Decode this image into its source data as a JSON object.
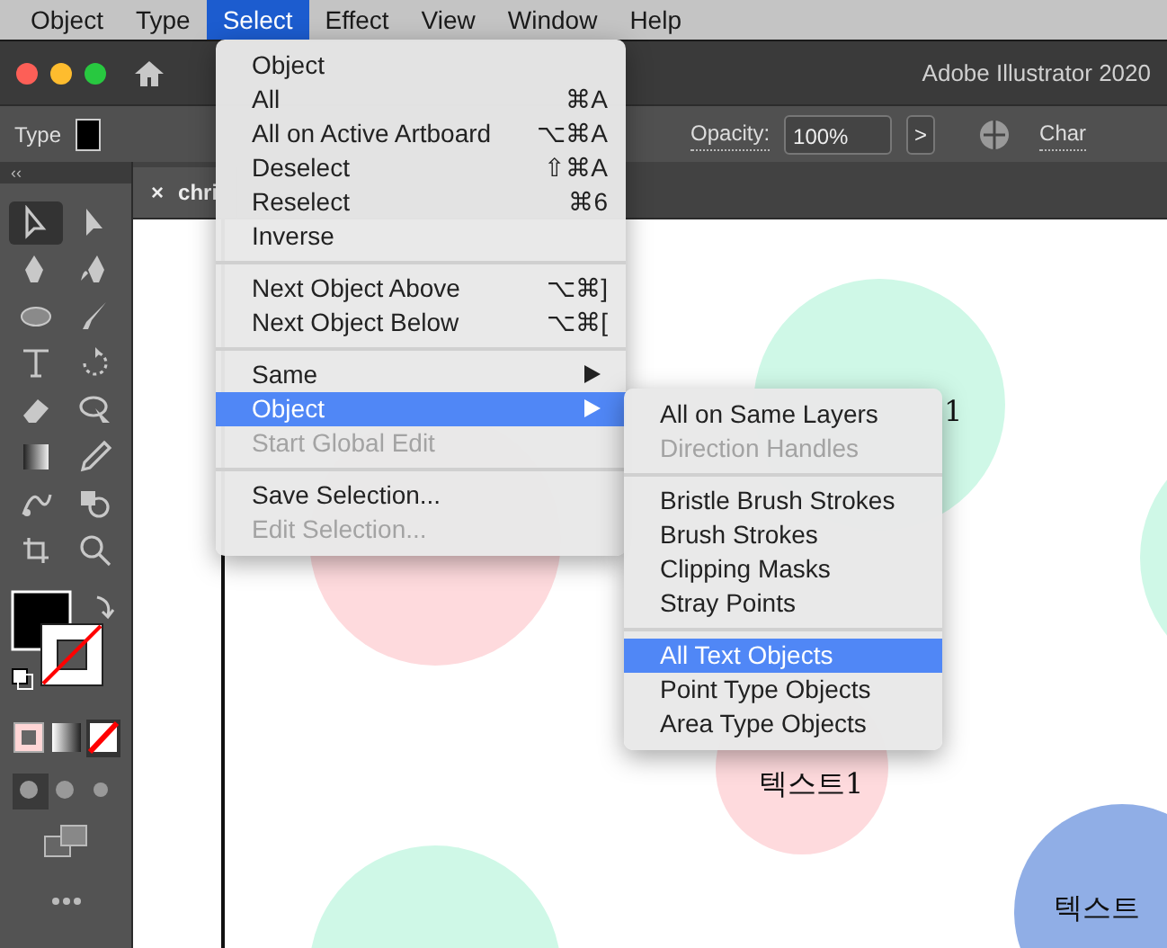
{
  "menubar": [
    {
      "label": "Object",
      "selected": false
    },
    {
      "label": "Type",
      "selected": false
    },
    {
      "label": "Select",
      "selected": true
    },
    {
      "label": "Effect",
      "selected": false
    },
    {
      "label": "View",
      "selected": false
    },
    {
      "label": "Window",
      "selected": false
    },
    {
      "label": "Help",
      "selected": false
    }
  ],
  "window": {
    "title": "Adobe Illustrator 2020"
  },
  "control_bar": {
    "label": "Type",
    "opacity_label": "Opacity:",
    "opacity_value": "100%",
    "opacity_button": ">",
    "cut_label": "Char"
  },
  "panel_header": "‹‹",
  "document_tab": {
    "close": "×",
    "label": "chri"
  },
  "select_menu": [
    {
      "kind": "item",
      "label": "Object",
      "disabled": false,
      "selected": false,
      "submenu": false
    },
    {
      "kind": "item",
      "label": "All",
      "shortcut": "⌘A",
      "disabled": false,
      "selected": false,
      "submenu": false
    },
    {
      "kind": "item",
      "label": "All on Active Artboard",
      "shortcut": "⌥⌘A",
      "disabled": false,
      "selected": false,
      "submenu": false
    },
    {
      "kind": "item",
      "label": "Deselect",
      "shortcut": "⇧⌘A",
      "disabled": false,
      "selected": false,
      "submenu": false
    },
    {
      "kind": "item",
      "label": "Reselect",
      "shortcut": "⌘6",
      "disabled": false,
      "selected": false,
      "submenu": false
    },
    {
      "kind": "item",
      "label": "Inverse",
      "disabled": false,
      "selected": false,
      "submenu": false
    },
    {
      "kind": "separator"
    },
    {
      "kind": "item",
      "label": "Next Object Above",
      "shortcut": "⌥⌘]",
      "disabled": false,
      "selected": false,
      "submenu": false
    },
    {
      "kind": "item",
      "label": "Next Object Below",
      "shortcut": "⌥⌘[",
      "disabled": false,
      "selected": false,
      "submenu": false
    },
    {
      "kind": "separator"
    },
    {
      "kind": "item",
      "label": "Same",
      "disabled": false,
      "selected": false,
      "submenu": true
    },
    {
      "kind": "item",
      "label": "Object",
      "disabled": false,
      "selected": true,
      "submenu": true
    },
    {
      "kind": "item",
      "label": "Start Global Edit",
      "disabled": true,
      "selected": false,
      "submenu": false
    },
    {
      "kind": "separator"
    },
    {
      "kind": "item",
      "label": "Save Selection...",
      "disabled": false,
      "selected": false,
      "submenu": false
    },
    {
      "kind": "item",
      "label": "Edit Selection...",
      "disabled": true,
      "selected": false,
      "submenu": false
    }
  ],
  "object_submenu": [
    {
      "kind": "item",
      "label": "All on Same Layers",
      "disabled": false,
      "selected": false
    },
    {
      "kind": "item",
      "label": "Direction Handles",
      "disabled": true,
      "selected": false
    },
    {
      "kind": "separator"
    },
    {
      "kind": "item",
      "label": "Bristle Brush Strokes",
      "disabled": false,
      "selected": false
    },
    {
      "kind": "item",
      "label": "Brush Strokes",
      "disabled": false,
      "selected": false
    },
    {
      "kind": "item",
      "label": "Clipping Masks",
      "disabled": false,
      "selected": false
    },
    {
      "kind": "item",
      "label": "Stray Points",
      "disabled": false,
      "selected": false
    },
    {
      "kind": "separator"
    },
    {
      "kind": "item",
      "label": "All Text Objects",
      "disabled": false,
      "selected": true
    },
    {
      "kind": "item",
      "label": "Point Type Objects",
      "disabled": false,
      "selected": false
    },
    {
      "kind": "item",
      "label": "Area Type Objects",
      "disabled": false,
      "selected": false
    }
  ],
  "canvas": {
    "circles": [
      {
        "color": "#cff8e7",
        "label": "1"
      },
      {
        "color": "#fedadd"
      },
      {
        "color": "#cff8e7"
      },
      {
        "color": "#fedadd",
        "label": "텍스트1"
      },
      {
        "color": "#90aee6",
        "label": "텍스트"
      },
      {
        "color": "#cff8e7"
      }
    ]
  }
}
